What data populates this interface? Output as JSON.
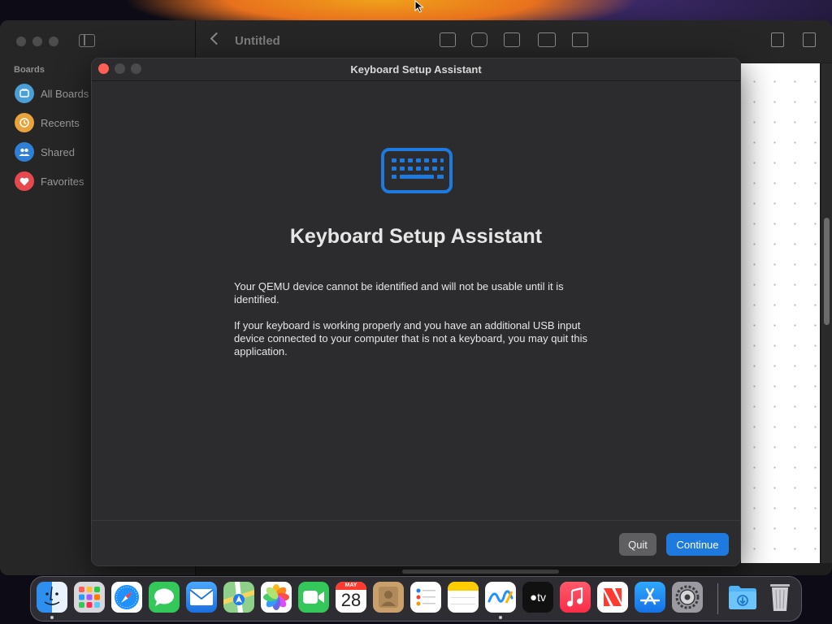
{
  "app": {
    "sidebar": {
      "heading": "Boards",
      "items": [
        {
          "label": "All Boards",
          "icon": "boards-icon",
          "color": "#4b9fd5"
        },
        {
          "label": "Recents",
          "icon": "clock-icon",
          "color": "#e8a33d"
        },
        {
          "label": "Shared",
          "icon": "people-icon",
          "color": "#2f7fd6"
        },
        {
          "label": "Favorites",
          "icon": "heart-icon",
          "color": "#e5484d"
        }
      ]
    },
    "toolbar": {
      "title": "Untitled",
      "tools": [
        "text-box-icon",
        "shapes-icon",
        "text-icon",
        "media-icon",
        "folder-icon"
      ],
      "right_tools": [
        "share-icon",
        "edit-icon"
      ]
    }
  },
  "dialog": {
    "window_title": "Keyboard Setup Assistant",
    "heading": "Keyboard Setup Assistant",
    "paragraph1": "Your QEMU device cannot be identified and will not be usable until it is identified.",
    "paragraph2": "If your keyboard is working properly and you have an additional USB input device connected to your computer that is not a keyboard, you may quit this application.",
    "quit_label": "Quit",
    "continue_label": "Continue",
    "accent_color": "#1f7ae0",
    "icon": "keyboard-icon"
  },
  "dock": {
    "apps": [
      {
        "name": "Finder",
        "icon": "finder-icon",
        "running": true
      },
      {
        "name": "Launchpad",
        "icon": "launchpad-icon",
        "running": false
      },
      {
        "name": "Safari",
        "icon": "safari-icon",
        "running": false
      },
      {
        "name": "Messages",
        "icon": "messages-icon",
        "running": false
      },
      {
        "name": "Mail",
        "icon": "mail-icon",
        "running": false
      },
      {
        "name": "Maps",
        "icon": "maps-icon",
        "running": false
      },
      {
        "name": "Photos",
        "icon": "photos-icon",
        "running": false
      },
      {
        "name": "FaceTime",
        "icon": "facetime-icon",
        "running": false
      },
      {
        "name": "Calendar",
        "icon": "calendar-icon",
        "running": false
      },
      {
        "name": "Contacts",
        "icon": "contacts-icon",
        "running": false
      },
      {
        "name": "Reminders",
        "icon": "reminders-icon",
        "running": false
      },
      {
        "name": "Notes",
        "icon": "notes-icon",
        "running": false
      },
      {
        "name": "Freeform",
        "icon": "freeform-icon",
        "running": true
      },
      {
        "name": "TV",
        "icon": "tv-icon",
        "running": false
      },
      {
        "name": "Music",
        "icon": "music-icon",
        "running": false
      },
      {
        "name": "News",
        "icon": "news-icon",
        "running": false
      },
      {
        "name": "App Store",
        "icon": "app-store-icon",
        "running": false
      },
      {
        "name": "System Settings",
        "icon": "settings-icon",
        "running": false
      }
    ],
    "calendar_month": "MAY",
    "calendar_day": "28",
    "tv_label": "tv",
    "downloads_icon": "downloads-folder-icon",
    "trash_icon": "trash-icon"
  }
}
